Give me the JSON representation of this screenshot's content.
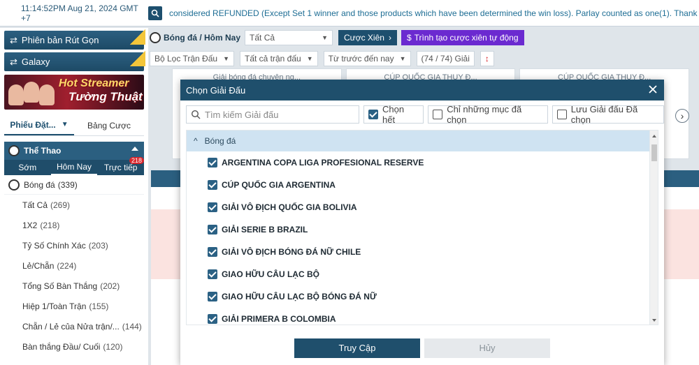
{
  "topbar": {
    "time": "11:14:52PM Aug 21, 2024 GMT +7",
    "marquee": "considered REFUNDED (Except Set 1 winner and those products which have been determined the win loss). Parlay counted as one(1). Thank you!"
  },
  "sidebar": {
    "banner1": "Phiên bản Rút Gọn",
    "banner2": "Galaxy",
    "promo_line1": "Hot Streamer",
    "promo_line2": "Tường Thuật",
    "tab_betslip": "Phiếu Đặt...",
    "tab_board": "Bảng Cược",
    "sport_head": "Thể Thao",
    "subtab_early": "Sớm",
    "subtab_today": "Hôm Nay",
    "subtab_live": "Trực tiếp",
    "live_badge": "218",
    "sport_name": "Bóng đá",
    "sport_count": "(339)",
    "menu": [
      {
        "label": "Tất Cả",
        "count": "(269)"
      },
      {
        "label": "1X2",
        "count": "(218)"
      },
      {
        "label": "Tỷ Số Chính Xác",
        "count": "(203)"
      },
      {
        "label": "Lẻ/Chẵn",
        "count": "(224)"
      },
      {
        "label": "Tổng Số Bàn Thắng",
        "count": "(202)"
      },
      {
        "label": "Hiệp 1/Toàn Trận",
        "count": "(155)"
      },
      {
        "label": "Chẵn / Lẻ của Nửa trận/...",
        "count": "(144)"
      },
      {
        "label": "Bàn thắng Đầu/ Cuối",
        "count": "(120)"
      }
    ]
  },
  "center": {
    "title": "Bóng đá / Hôm Nay",
    "select_all": "Tất Cả",
    "parlay_btn": "Cược Xiên",
    "auto_btn": "Trình tạo cược xiên tự động",
    "filter_league": "Bộ Lọc Trận Đấu",
    "filter_matches": "Tất cả trận đấu",
    "filter_time": "Từ trước đến nay",
    "league_count": "(74 / 74) Giải",
    "card1": "Giải bóng đá chuyên ng...",
    "card2": "CÚP QUỐC GIA THUY Đ...",
    "card3": "CÚP QUỐC GIA THUY Đ..."
  },
  "modal": {
    "title": "Chọn Giải Đấu",
    "search_placeholder": "Tìm kiếm Giải đấu",
    "select_all": "Chọn hết",
    "only_selected": "Chỉ những mục đã chọn",
    "save_selected": "Lưu Giải đấu Đã chọn",
    "group": "Bóng đá",
    "leagues": [
      "ARGENTINA COPA LIGA PROFESIONAL RESERVE",
      "CÚP QUỐC GIA ARGENTINA",
      "GIẢI VÔ ĐỊCH QUỐC GIA BOLIVIA",
      "GIẢI SERIE B BRAZIL",
      "GIẢI VÔ ĐỊCH BÓNG ĐÁ NỮ CHILE",
      "GIAO HỮU CÂU LẠC BỘ",
      "GIAO HỮU CÂU LẠC BỘ BÓNG ĐÁ NỮ",
      "GIẢI PRIMERA B COLOMBIA"
    ],
    "ok": "Truy Cập",
    "cancel": "Hủy"
  },
  "colors": {
    "header": "#1f4f6c",
    "accent": "#2b6184",
    "purple": "#6b2ad0"
  }
}
